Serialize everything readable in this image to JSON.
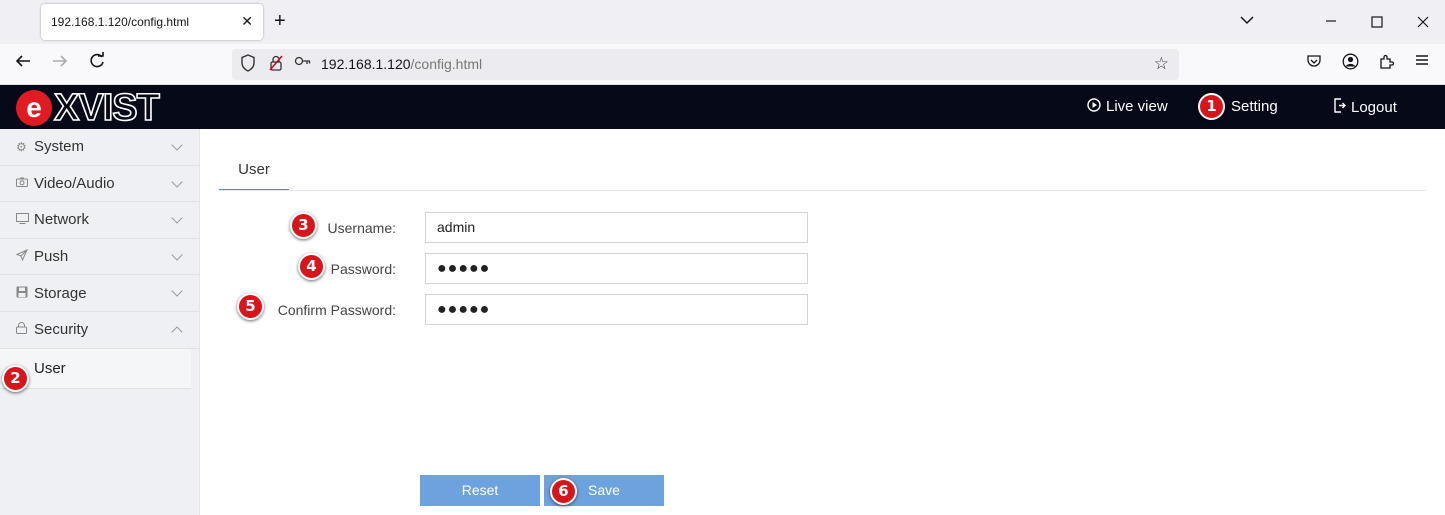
{
  "browser": {
    "tab_title": "192.168.1.120/config.html",
    "tab_close": "✕",
    "new_tab": "+",
    "url_host": "192.168.1.120",
    "url_path": "/config.html"
  },
  "app": {
    "logo_text": "eXVIST",
    "nav": {
      "live_view": "Live view",
      "setting": "Setting",
      "logout": "Logout"
    }
  },
  "sidebar": {
    "items": [
      {
        "label": "System",
        "icon": "gear-icon",
        "expanded": false
      },
      {
        "label": "Video/Audio",
        "icon": "camera-icon",
        "expanded": false
      },
      {
        "label": "Network",
        "icon": "monitor-icon",
        "expanded": false
      },
      {
        "label": "Push",
        "icon": "send-icon",
        "expanded": false
      },
      {
        "label": "Storage",
        "icon": "disk-icon",
        "expanded": false
      },
      {
        "label": "Security",
        "icon": "lock-icon",
        "expanded": true
      }
    ],
    "sub_items": [
      {
        "label": "User"
      }
    ]
  },
  "main": {
    "tab": "User",
    "form": {
      "username_label": "Username:",
      "username_value": "admin",
      "password_label": "Password:",
      "password_value": "●●●●●",
      "confirm_label": "Confirm Password:",
      "confirm_value": "●●●●●"
    },
    "buttons": {
      "reset": "Reset",
      "save": "Save"
    }
  },
  "annotations": [
    "1",
    "2",
    "3",
    "4",
    "5",
    "6"
  ],
  "colors": {
    "header_bg": "#060a18",
    "accent": "#4a90d9",
    "button": "#6ca3de",
    "badge": "#d9141b"
  }
}
